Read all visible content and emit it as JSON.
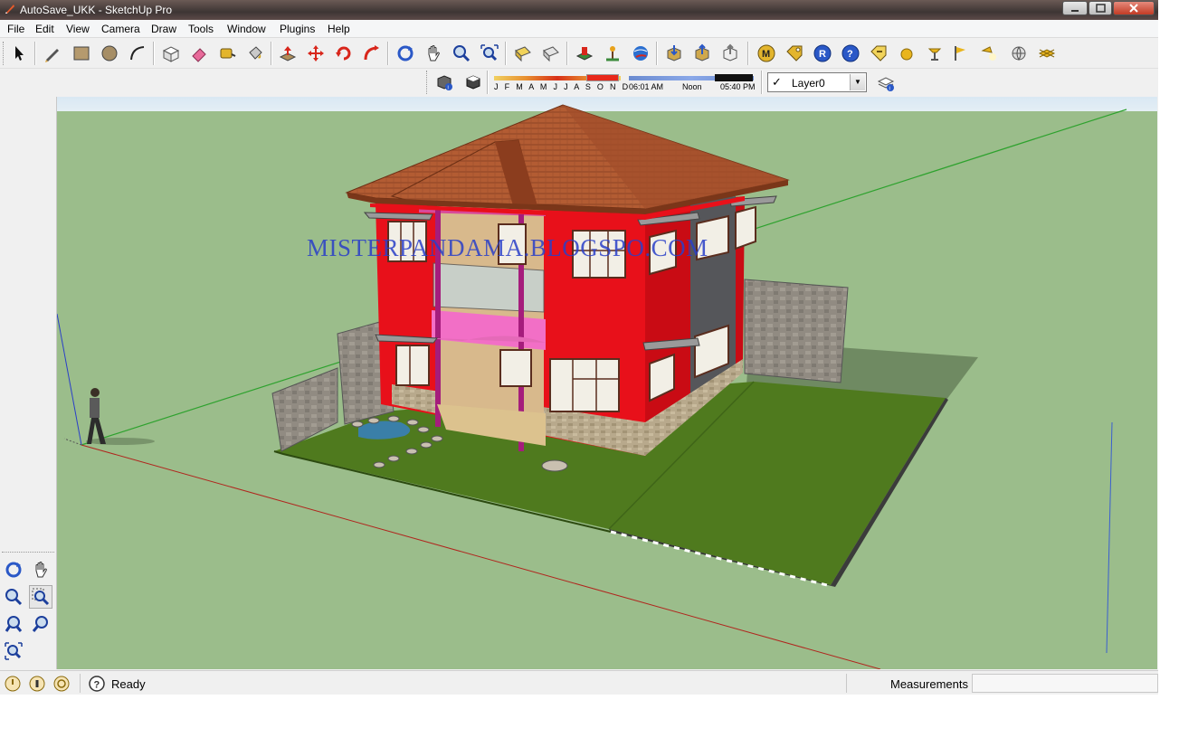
{
  "window": {
    "title": "AutoSave_UKK - SketchUp Pro"
  },
  "menu": {
    "items": [
      "File",
      "Edit",
      "View",
      "Camera",
      "Draw",
      "Tools",
      "Window",
      "Plugins",
      "Help"
    ]
  },
  "toolbar": {
    "tools": [
      {
        "name": "select-icon"
      },
      {
        "name": "pencil-icon"
      },
      {
        "name": "rectangle-icon"
      },
      {
        "name": "circle-icon"
      },
      {
        "name": "arc-icon"
      },
      {
        "name": "make-component-icon"
      },
      {
        "name": "eraser-icon"
      },
      {
        "name": "tape-measure-icon"
      },
      {
        "name": "paint-bucket-icon"
      },
      {
        "name": "push-pull-icon"
      },
      {
        "name": "move-icon"
      },
      {
        "name": "rotate-icon"
      },
      {
        "name": "follow-me-icon"
      },
      {
        "name": "orbit-icon"
      },
      {
        "name": "pan-icon"
      },
      {
        "name": "zoom-icon"
      },
      {
        "name": "zoom-extents-icon"
      },
      {
        "name": "previous-view-icon"
      },
      {
        "name": "next-view-icon"
      },
      {
        "name": "add-location-icon"
      },
      {
        "name": "toggle-terrain-icon"
      },
      {
        "name": "get-models-icon"
      },
      {
        "name": "share-model-icon"
      },
      {
        "name": "share-component-icon"
      },
      {
        "name": "ruby-console-icon"
      },
      {
        "name": "m-plugin-icon"
      },
      {
        "name": "tag-icon"
      },
      {
        "name": "r-plugin-icon"
      },
      {
        "name": "help-icon"
      },
      {
        "name": "label-icon"
      },
      {
        "name": "sphere-icon"
      },
      {
        "name": "lamp-icon"
      },
      {
        "name": "flag-icon"
      },
      {
        "name": "pointer-light-icon"
      },
      {
        "name": "globe-icon"
      },
      {
        "name": "plane-icon"
      }
    ]
  },
  "shadow": {
    "months": "J F M A M J J A S O N D",
    "time_start": "06:01 AM",
    "time_mid": "Noon",
    "time_end": "05:40 PM"
  },
  "layers": {
    "current": "Layer0",
    "check": "✓"
  },
  "viewport": {
    "watermark": "MISTERPANDAMA.BLOGSPO.COM",
    "sky_color": "#d8e6f0",
    "ground_color": "#9bbd8b"
  },
  "status": {
    "ready_text": "Ready",
    "measurements_label": "Measurements",
    "measurements_value": ""
  },
  "colors": {
    "wall_red": "#e8101a",
    "roof": "#b15a32",
    "lawn": "#4f7a1e",
    "stone_wall": "#8f8a80"
  }
}
